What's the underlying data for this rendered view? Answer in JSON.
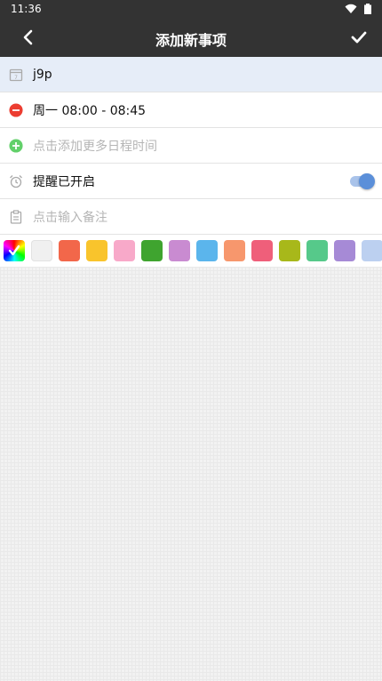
{
  "status": {
    "time": "11:36"
  },
  "appbar": {
    "title": "添加新事项"
  },
  "rows": {
    "name": "j9p",
    "schedule": "周一 08:00 - 08:45",
    "add_time_placeholder": "点击添加更多日程时间",
    "reminder": "提醒已开启",
    "note_placeholder": "点击输入备注"
  },
  "reminder_enabled": true,
  "colors": [
    "#f0f0f0",
    "#f2674a",
    "#f9c42c",
    "#f8a9c9",
    "#3fa42f",
    "#c98bd1",
    "#5bb5ec",
    "#f7976d",
    "#ef5f7a",
    "#a8b81a",
    "#56c98a",
    "#a68ad6",
    "#bcd0f0"
  ]
}
